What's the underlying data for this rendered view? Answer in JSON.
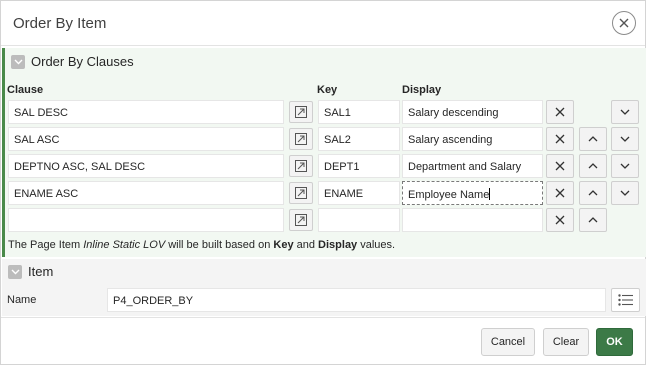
{
  "dialog": {
    "title": "Order By Item"
  },
  "order_region": {
    "title": "Order By Clauses",
    "columns": {
      "clause": "Clause",
      "key": "Key",
      "display": "Display"
    },
    "rows": [
      {
        "clause": "SAL DESC",
        "key": "SAL1",
        "display": "Salary descending"
      },
      {
        "clause": "SAL ASC",
        "key": "SAL2",
        "display": "Salary ascending"
      },
      {
        "clause": "DEPTNO ASC, SAL DESC",
        "key": "DEPT1",
        "display": "Department and Salary"
      },
      {
        "clause": "ENAME ASC",
        "key": "ENAME",
        "display": "Employee Name"
      },
      {
        "clause": "",
        "key": "",
        "display": ""
      }
    ],
    "note": {
      "p1": "The Page Item ",
      "p2": "Inline Static LOV",
      "p3": " will be built based on ",
      "p4": "Key",
      "p5": " and ",
      "p6": "Display",
      "p7": " values."
    }
  },
  "item_region": {
    "title": "Item",
    "name_label": "Name",
    "name_value": "P4_ORDER_BY"
  },
  "footer": {
    "cancel": "Cancel",
    "clear": "Clear",
    "ok": "OK"
  },
  "colors": {
    "accent": "#3c7a47",
    "region_bg": "#f2f8f2"
  }
}
